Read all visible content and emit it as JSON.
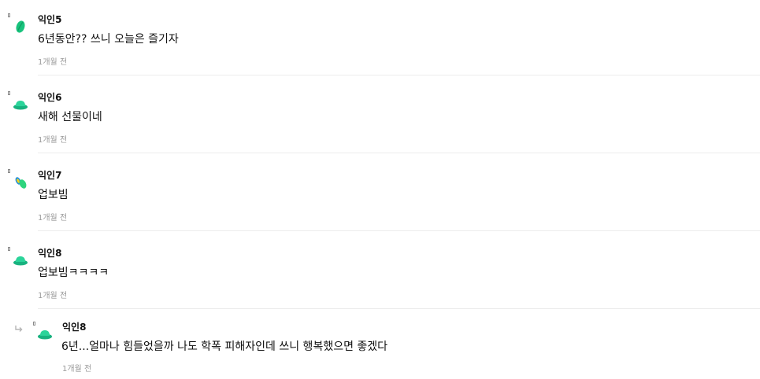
{
  "comments": [
    {
      "nickname": "익인5",
      "text": "6년동안?? 쓰니 오늘은 즐기자",
      "time": "1개월 전",
      "avatar_icon": "green-leaf-icon",
      "colors": {
        "primary": "#19c37d",
        "secondary": "#0f9f63"
      }
    },
    {
      "nickname": "익인6",
      "text": "새해 선물이네",
      "time": "1개월 전",
      "avatar_icon": "green-hat-icon",
      "colors": {
        "primary": "#2bd49a",
        "secondary": "#18b27f"
      }
    },
    {
      "nickname": "익인7",
      "text": "업보빔",
      "time": "1개월 전",
      "avatar_icon": "green-capsule-icon",
      "colors": {
        "primary": "#2ed47d",
        "secondary": "#1f8fe0",
        "accent": "#f2d21d"
      }
    },
    {
      "nickname": "익인8",
      "text": "업보빔ㅋㅋㅋㅋ",
      "time": "1개월 전",
      "avatar_icon": "green-hat-icon",
      "colors": {
        "primary": "#2bd49a",
        "secondary": "#18b27f"
      }
    },
    {
      "nickname": "익인8",
      "text": "6년...얼마나 힘들었을까 나도 학폭 피해자인데 쓰니 행복했으면 좋겠다",
      "time": "1개월 전",
      "avatar_icon": "green-hat-icon",
      "is_reply": true,
      "colors": {
        "primary": "#2bd49a",
        "secondary": "#18b27f"
      }
    }
  ]
}
